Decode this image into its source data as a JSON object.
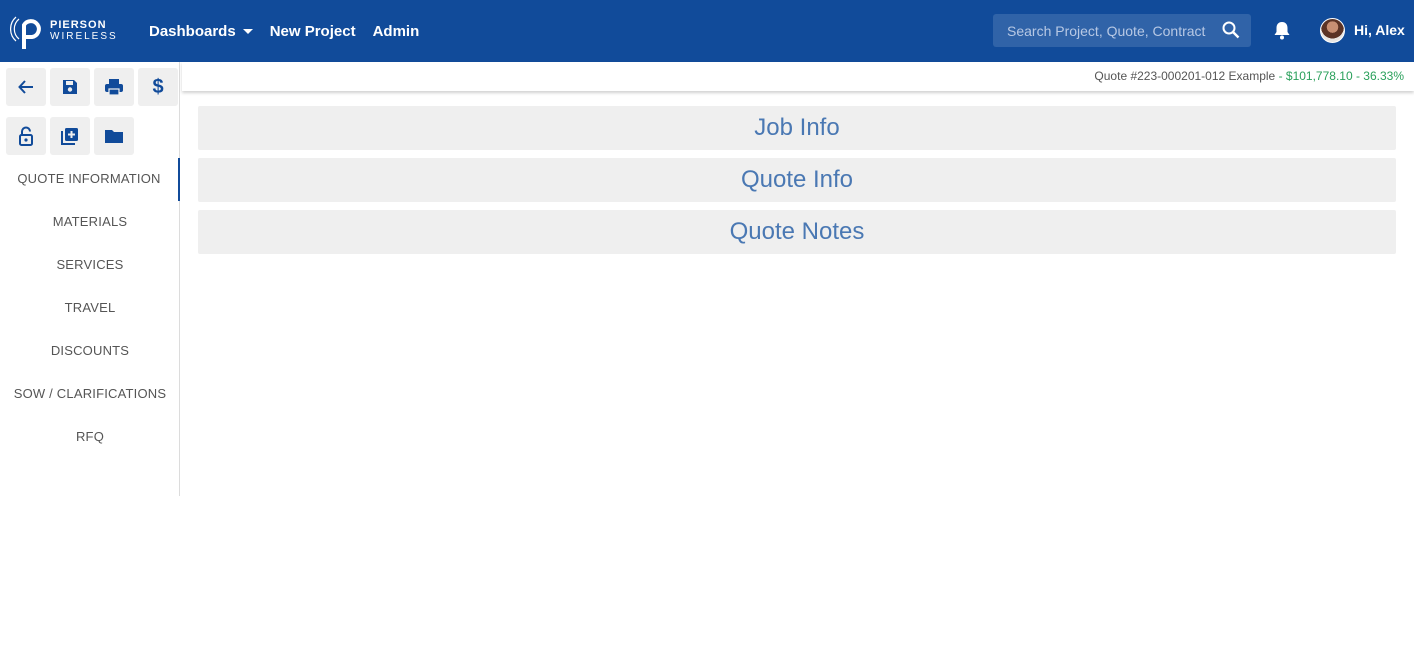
{
  "brand": {
    "line1": "PIERSON",
    "line2": "WIRELESS"
  },
  "nav": {
    "dashboards": "Dashboards",
    "new_project": "New Project",
    "admin": "Admin"
  },
  "search": {
    "placeholder": "Search Project, Quote, Contract"
  },
  "user": {
    "greeting": "Hi, Alex"
  },
  "toolbar": {
    "icons": [
      "back-arrow-icon",
      "save-icon",
      "print-icon",
      "dollar-icon",
      "unlock-icon",
      "add-copy-icon",
      "folder-icon"
    ]
  },
  "sidebar": {
    "items": [
      {
        "label": "QUOTE INFORMATION",
        "active": true
      },
      {
        "label": "MATERIALS"
      },
      {
        "label": "SERVICES"
      },
      {
        "label": "TRAVEL"
      },
      {
        "label": "DISCOUNTS"
      },
      {
        "label": "SOW / CLARIFICATIONS"
      },
      {
        "label": "RFQ"
      }
    ]
  },
  "quote": {
    "title": "Quote #223-000201-012 Example",
    "amount": "- $101,778.10 - 36.33%"
  },
  "sections": {
    "job_info": "Job Info",
    "quote_info": "Quote Info",
    "quote_notes": "Quote Notes"
  },
  "colors": {
    "primary": "#114b9a",
    "accent_text": "#4a78b3",
    "money": "#2aa05b"
  }
}
